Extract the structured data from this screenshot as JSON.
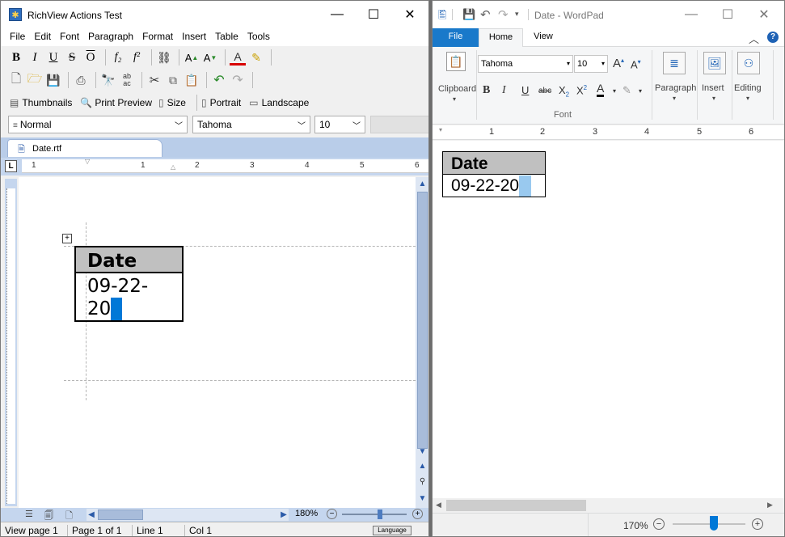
{
  "left": {
    "title": "RichView Actions Test",
    "menu": [
      "File",
      "Edit",
      "Font",
      "Paragraph",
      "Format",
      "Insert",
      "Table",
      "Tools"
    ],
    "toolbar3": {
      "thumbnails": "Thumbnails",
      "print_preview": "Print Preview",
      "size": "Size",
      "portrait": "Portrait",
      "landscape": "Landscape"
    },
    "style_combo": "Normal",
    "font_combo": "Tahoma",
    "size_combo": "10",
    "tab_name": "Date.rtf",
    "ruler_ticks": [
      "1",
      "1",
      "2",
      "3",
      "4",
      "5",
      "6"
    ],
    "table": {
      "header": "Date",
      "cell_line1": "09-22-",
      "cell_line2": "20"
    },
    "zoom": "180%",
    "status": {
      "view_page": "View page 1",
      "page_of": "Page 1 of 1",
      "line": "Line 1",
      "col": "Col 1",
      "language": "Language"
    }
  },
  "right": {
    "title": "Date - WordPad",
    "tabs": {
      "file": "File",
      "home": "Home",
      "view": "View"
    },
    "font_combo": "Tahoma",
    "size_combo": "10",
    "groups": {
      "clipboard": "Clipboard",
      "font": "Font",
      "paragraph": "Paragraph",
      "insert": "Insert",
      "editing": "Editing"
    },
    "ruler_ticks": [
      "1",
      "2",
      "3",
      "4",
      "5",
      "6"
    ],
    "table": {
      "header": "Date",
      "cell": "09-22-20"
    },
    "zoom": "170%"
  },
  "colors": {
    "accent": "#0078d7",
    "file_tab": "#1979ca",
    "selection_left": "#0078d7",
    "selection_right": "#99c9ef",
    "header_cell": "#c0c0c0"
  }
}
